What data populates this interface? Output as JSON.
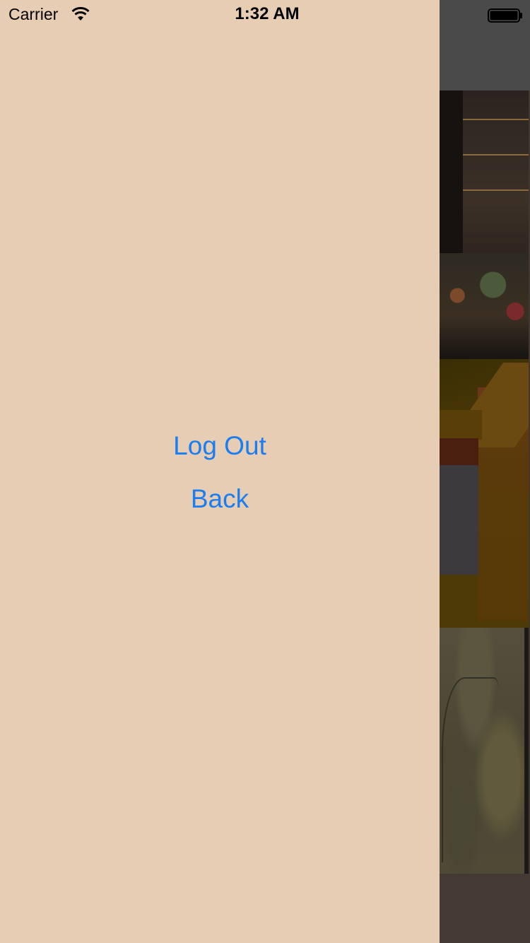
{
  "status_bar": {
    "carrier": "Carrier",
    "time": "1:32 AM",
    "icons": [
      "wifi-icon",
      "battery-icon"
    ]
  },
  "drawer": {
    "background": "#e7cdb3",
    "items": [
      {
        "label": "Log Out"
      },
      {
        "label": "Back"
      }
    ],
    "link_color": "#1a7df2"
  }
}
